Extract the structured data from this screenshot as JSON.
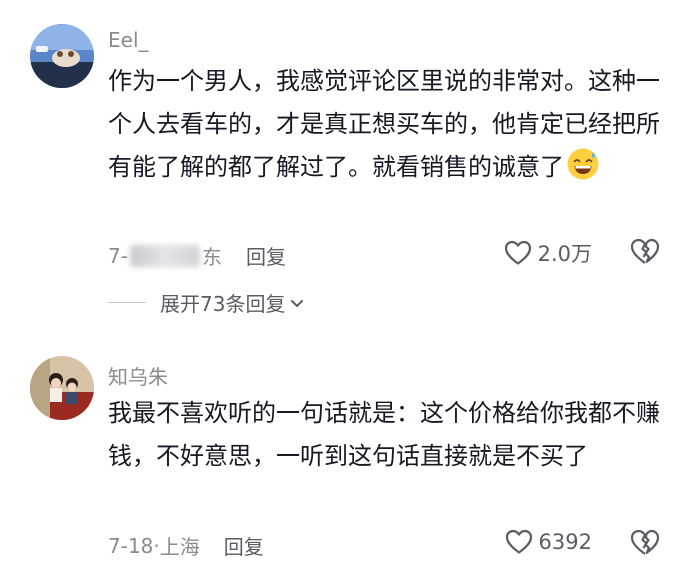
{
  "comments": [
    {
      "username": "Eel_",
      "text": "作为一个男人，我感觉评论区里说的非常对。这种一个人去看车的，才是真正想买车的，他肯定已经把所有能了解的都了解过了。就看销售的诚意了",
      "emoji": "grinning-sweat-emoji",
      "date": "7-",
      "location": "东",
      "reply_label": "回复",
      "likes": "2.0万",
      "expand_label": "展开73条回复"
    },
    {
      "username": "知乌朱",
      "text": "我最不喜欢听的一句话就是：这个价格给你我都不赚钱，不好意思，一听到这句话直接就是不买了",
      "date": "7-18",
      "location": "上海",
      "separator": "·",
      "reply_label": "回复",
      "likes": "6392"
    }
  ],
  "icons": {
    "like": "heart-outline-icon",
    "dislike": "broken-heart-icon",
    "expand": "chevron-down-icon"
  },
  "colors": {
    "text": "#161823",
    "secondary": "#8a8b91",
    "icon": "#5b5b63"
  }
}
